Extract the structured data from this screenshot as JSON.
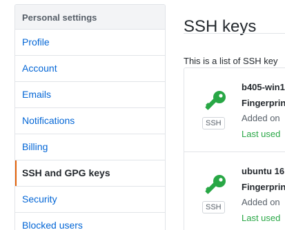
{
  "sidebar": {
    "header": "Personal settings",
    "items": [
      {
        "label": "Profile"
      },
      {
        "label": "Account"
      },
      {
        "label": "Emails"
      },
      {
        "label": "Notifications"
      },
      {
        "label": "Billing"
      },
      {
        "label": "SSH and GPG keys",
        "selected": true
      },
      {
        "label": "Security"
      },
      {
        "label": "Blocked users"
      }
    ]
  },
  "main": {
    "title": "SSH keys",
    "intro": "This is a list of SSH key",
    "keys": [
      {
        "title": "b405-win1",
        "fingerprint": "Fingerprin",
        "added": "Added on",
        "last_used": "Last used",
        "type_badge": "SSH",
        "icon": "key-icon"
      },
      {
        "title": "ubuntu 16",
        "fingerprint": "Fingerprin",
        "added": "Added on",
        "last_used": "Last used",
        "type_badge": "SSH",
        "icon": "key-icon"
      }
    ]
  },
  "colors": {
    "link": "#0366d6",
    "selected_accent": "#e36209",
    "key_icon": "#28a745",
    "last_used": "#28a745"
  }
}
